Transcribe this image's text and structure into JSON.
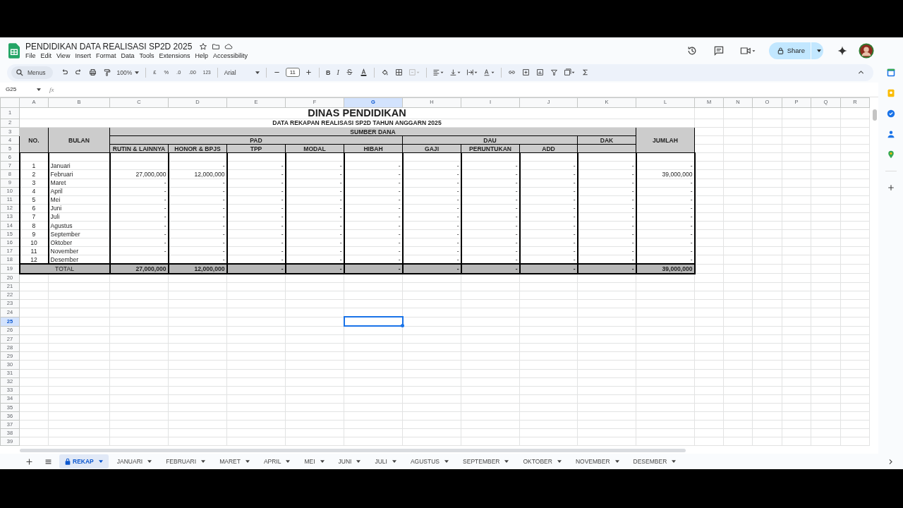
{
  "document": {
    "title": "PENDIDIKAN DATA REALISASI SP2D 2025",
    "share": "Share"
  },
  "menu": [
    "File",
    "Edit",
    "View",
    "Insert",
    "Format",
    "Data",
    "Tools",
    "Extensions",
    "Help",
    "Accessibility"
  ],
  "toolbar": {
    "search": "Menus",
    "zoom": "100%",
    "currency": "£",
    "percent": "%",
    "decimal_decrease": ".0",
    "decimal_increase": ".00",
    "number_format": "123",
    "font": "Arial",
    "font_size": "11",
    "bold": "B",
    "italic": "I"
  },
  "formula_bar": {
    "name_box": "G25",
    "fx": "fx"
  },
  "column_headers": [
    {
      "label": "A",
      "selected": false
    },
    {
      "label": "B",
      "selected": false
    },
    {
      "label": "C",
      "selected": false
    },
    {
      "label": "D",
      "selected": false
    },
    {
      "label": "E",
      "selected": false
    },
    {
      "label": "F",
      "selected": false
    },
    {
      "label": "G",
      "selected": true
    },
    {
      "label": "H",
      "selected": false
    },
    {
      "label": "I",
      "selected": false
    },
    {
      "label": "J",
      "selected": false
    },
    {
      "label": "K",
      "selected": false
    },
    {
      "label": "L",
      "selected": false
    },
    {
      "label": "M",
      "selected": false
    },
    {
      "label": "N",
      "selected": false
    },
    {
      "label": "O",
      "selected": false
    },
    {
      "label": "P",
      "selected": false
    },
    {
      "label": "Q",
      "selected": false
    },
    {
      "label": "R",
      "selected": false
    }
  ],
  "row_numbers": [
    {
      "label": "1",
      "selected": false
    },
    {
      "label": "2",
      "selected": false
    },
    {
      "label": "3",
      "selected": false
    },
    {
      "label": "4",
      "selected": false
    },
    {
      "label": "5",
      "selected": false
    },
    {
      "label": "6",
      "selected": false
    },
    {
      "label": "7",
      "selected": false
    },
    {
      "label": "8",
      "selected": false
    },
    {
      "label": "9",
      "selected": false
    },
    {
      "label": "10",
      "selected": false
    },
    {
      "label": "11",
      "selected": false
    },
    {
      "label": "12",
      "selected": false
    },
    {
      "label": "13",
      "selected": false
    },
    {
      "label": "14",
      "selected": false
    },
    {
      "label": "15",
      "selected": false
    },
    {
      "label": "16",
      "selected": false
    },
    {
      "label": "17",
      "selected": false
    },
    {
      "label": "18",
      "selected": false
    },
    {
      "label": "19",
      "selected": false
    },
    {
      "label": "20",
      "selected": false
    },
    {
      "label": "21",
      "selected": false
    },
    {
      "label": "22",
      "selected": false
    },
    {
      "label": "23",
      "selected": false
    },
    {
      "label": "24",
      "selected": false
    },
    {
      "label": "25",
      "selected": true
    },
    {
      "label": "26",
      "selected": false
    },
    {
      "label": "27",
      "selected": false
    },
    {
      "label": "28",
      "selected": false
    },
    {
      "label": "29",
      "selected": false
    },
    {
      "label": "30",
      "selected": false
    },
    {
      "label": "31",
      "selected": false
    },
    {
      "label": "32",
      "selected": false
    },
    {
      "label": "33",
      "selected": false
    },
    {
      "label": "34",
      "selected": false
    },
    {
      "label": "35",
      "selected": false
    },
    {
      "label": "36",
      "selected": false
    },
    {
      "label": "37",
      "selected": false
    },
    {
      "label": "38",
      "selected": false
    },
    {
      "label": "39",
      "selected": false
    }
  ],
  "report": {
    "title": "DINAS PENDIDIKAN",
    "subtitle": "DATA REKAPAN REALISASI SP2D TAHUN ANGGARN 2025",
    "headers": {
      "no": "NO.",
      "month": "BULAN",
      "source": "SUMBER  DANA",
      "pad": "PAD",
      "dau": "DAU",
      "dak": "DAK",
      "total": "JUMLAH",
      "pad_columns": [
        "RUTIN & LAINNYA",
        "HONOR & BPJS",
        "TPP",
        "MODAL",
        "HIBAH"
      ],
      "dau_columns": [
        "GAJI",
        "PERUNTUKAN",
        "ADD"
      ]
    },
    "rows": [
      {
        "no": "1",
        "month": "Januari",
        "values": [
          "-",
          "-",
          "-",
          "-",
          "-",
          "-",
          "-",
          "-",
          "-"
        ]
      },
      {
        "no": "2",
        "month": "Februari",
        "rutin_lainnya": "27,000,000",
        "values": [
          "12,000,000",
          "-",
          "-",
          "-",
          "-",
          "-",
          "-",
          "-",
          "39,000,000"
        ]
      },
      {
        "no": "3",
        "month": "Maret",
        "rutin_lainnya": "-",
        "values": [
          "-",
          "-",
          "-",
          "-",
          "-",
          "-",
          "-",
          "-",
          "-"
        ]
      },
      {
        "no": "4",
        "month": "April",
        "rutin_lainnya": "-",
        "values": [
          "-",
          "-",
          "-",
          "-",
          "-",
          "-",
          "-",
          "-",
          "-"
        ]
      },
      {
        "no": "5",
        "month": "Mei",
        "rutin_lainnya": "-",
        "values": [
          "-",
          "-",
          "-",
          "-",
          "-",
          "-",
          "-",
          "-",
          "-"
        ]
      },
      {
        "no": "6",
        "month": "Juni",
        "rutin_lainnya": "-",
        "values": [
          "-",
          "-",
          "-",
          "-",
          "-",
          "-",
          "-",
          "-",
          "-"
        ]
      },
      {
        "no": "7",
        "month": "Juli",
        "rutin_lainnya": "-",
        "values": [
          "-",
          "-",
          "-",
          "-",
          "-",
          "-",
          "-",
          "-",
          "-"
        ]
      },
      {
        "no": "8",
        "month": "Agustus",
        "rutin_lainnya": "-",
        "values": [
          "-",
          "-",
          "-",
          "-",
          "-",
          "-",
          "-",
          "-",
          "-"
        ]
      },
      {
        "no": "9",
        "month": "September",
        "rutin_lainnya": "-",
        "values": [
          "-",
          "-",
          "-",
          "-",
          "-",
          "-",
          "-",
          "-",
          "-"
        ]
      },
      {
        "no": "10",
        "month": "Oktober",
        "rutin_lainnya": "-",
        "values": [
          "-",
          "-",
          "-",
          "-",
          "-",
          "-",
          "-",
          "-",
          "-"
        ]
      },
      {
        "no": "11",
        "month": "November",
        "rutin_lainnya": "-",
        "values": [
          "-",
          "-",
          "-",
          "-",
          "-",
          "-",
          "-",
          "-",
          "-"
        ]
      },
      {
        "no": "12",
        "month": "Desember",
        "values": [
          "-",
          "-",
          "-",
          "-",
          "-",
          "-",
          "-",
          "-",
          "-"
        ]
      }
    ],
    "total": {
      "label": "TOTAL",
      "rutin_lainnya": "27,000,000",
      "values": [
        "12,000,000",
        "-",
        "-",
        "-",
        "-",
        "-",
        "-",
        "-",
        "39,000,000"
      ]
    }
  },
  "sheet_tabs": [
    {
      "label": "REKAP",
      "selected": true,
      "protected": true
    },
    {
      "label": "JANUARI",
      "selected": false,
      "protected": false
    },
    {
      "label": "FEBRUARI",
      "selected": false,
      "protected": false
    },
    {
      "label": "MARET",
      "selected": false,
      "protected": false
    },
    {
      "label": "APRIL",
      "selected": false,
      "protected": false
    },
    {
      "label": "MEI",
      "selected": false,
      "protected": false
    },
    {
      "label": "JUNI",
      "selected": false,
      "protected": false
    },
    {
      "label": "JULI",
      "selected": false,
      "protected": false
    },
    {
      "label": "AGUSTUS",
      "selected": false,
      "protected": false
    },
    {
      "label": "SEPTEMBER",
      "selected": false,
      "protected": false
    },
    {
      "label": "OKTOBER",
      "selected": false,
      "protected": false
    },
    {
      "label": "NOVEMBER",
      "selected": false,
      "protected": false
    },
    {
      "label": "DESEMBER",
      "selected": false,
      "protected": false
    }
  ]
}
